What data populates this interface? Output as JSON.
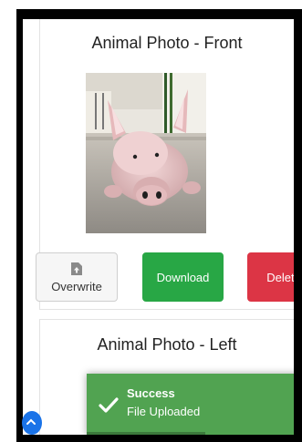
{
  "cards": [
    {
      "title": "Animal Photo - Front"
    },
    {
      "title": "Animal Photo - Left"
    }
  ],
  "actions": {
    "overwrite_label": "Overwrite",
    "download_label": "Download",
    "delete_label": "Delete"
  },
  "toast": {
    "title": "Success",
    "message": "File Uploaded"
  },
  "colors": {
    "download": "#28a745",
    "delete": "#dc3545",
    "toast": "#51a351",
    "fab": "#1a73e8"
  },
  "icons": {
    "overwrite": "upload-file-icon",
    "toast": "check-icon",
    "fab": "chevron-icon"
  }
}
